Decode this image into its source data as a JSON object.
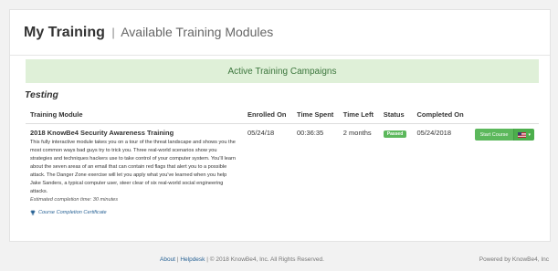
{
  "header": {
    "title": "My Training",
    "separator": "|",
    "subtitle": "Available Training Modules"
  },
  "campaign_banner": "Active Training Campaigns",
  "section_title": "Testing",
  "table": {
    "columns": [
      "Training Module",
      "Enrolled On",
      "Time Spent",
      "Time Left",
      "Status",
      "Completed On"
    ],
    "rows": [
      {
        "module_name": "2018 KnowBe4 Security Awareness Training",
        "description": "This fully interactive module takes you on a tour of the threat landscape and shows you the most common ways bad guys try to trick you. Three real-world scenarios show you strategies and techniques hackers use to take control of your computer system. You'll learn about the seven areas of an email that can contain red flags that alert you to a possible attack. The Danger Zone exercise will let you apply what you've learned when you help Jake Sanders, a typical computer user, steer clear of six real-world social engineering attacks.",
        "estimated_time": "Estimated completion time: 30 minutes",
        "certificate_link": "Course Completion Certificate",
        "enrolled_on": "05/24/18",
        "time_spent": "00:36:35",
        "time_left": "2 months",
        "status": "Passed",
        "completed_on": "05/24/2018",
        "action_label": "Start Course",
        "language_icon": "us-flag-icon"
      }
    ]
  },
  "footer": {
    "about": "About",
    "sep1": "|",
    "helpdesk": "Helpdesk",
    "sep2": "|",
    "copyright": "© 2018 KnowBe4, Inc. All Rights Reserved.",
    "powered_by": "Powered by KnowBe4, Inc"
  },
  "colors": {
    "success": "#5cb85c",
    "banner_bg": "#dff0d8",
    "link": "#2a6496"
  }
}
